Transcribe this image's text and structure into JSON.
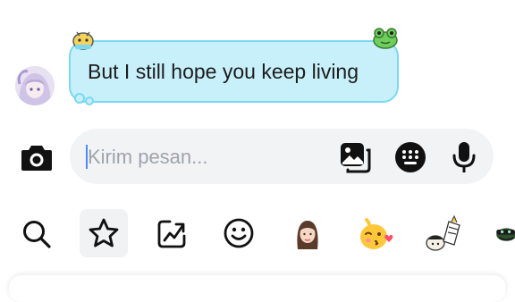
{
  "message": {
    "text": "But I still hope you keep living",
    "bubble_color": "#c8f0fb",
    "bubble_border": "#7ad8f4",
    "sender_avatar": "anime-girl-avatar"
  },
  "composer": {
    "placeholder": "Kirim pesan...",
    "left_icon": "camera-icon",
    "right_icons": [
      "gallery-icon",
      "dots-grid-icon",
      "microphone-icon"
    ]
  },
  "toolbar": {
    "items": [
      "search-icon",
      "star-icon",
      "trend-chart-icon",
      "smiley-icon",
      "avatar-sticker-icon",
      "kissing-emoji-sticker-icon",
      "character-sticker-icon",
      "frog-sticker-icon"
    ],
    "selected": "star-icon"
  }
}
